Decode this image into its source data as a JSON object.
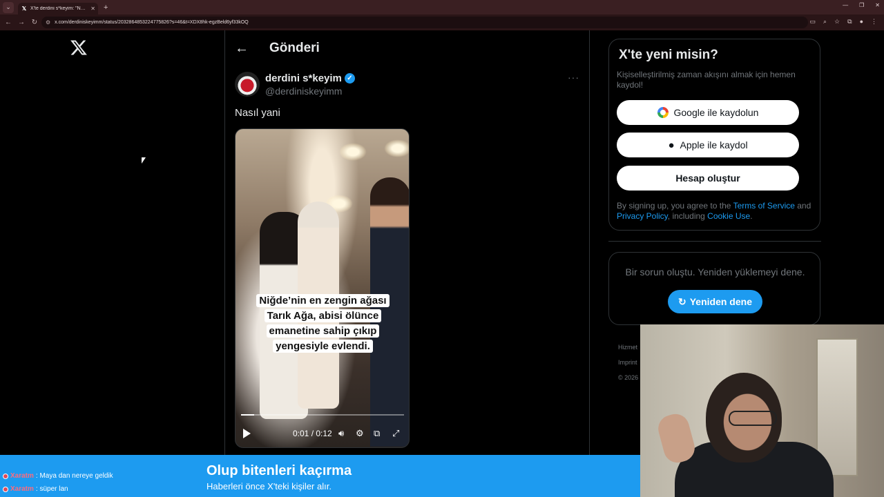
{
  "browser": {
    "tab_title": "X'te derdini s*keyim: \"Nasıl yani\"",
    "url": "x.com/derdiniskeyimm/status/2032864853224775826?s=46&t=XDX8hk-egzBeld6yf33kOQ",
    "tab_close": "✕",
    "new_tab": "+"
  },
  "post": {
    "header_title": "Gönderi",
    "author_name": "derdini s*keyim",
    "author_handle": "@derdiniskeyimm",
    "text": "Nasıl yani",
    "more": "···"
  },
  "video": {
    "caption": "Niğde’nin en zengin ağası Tarık Ağa, abisi ölünce emanetine sahip çıkıp yengesiyle evlendi.",
    "time": "0:01 / 0:12",
    "progress": 0.08
  },
  "signup": {
    "title": "X'te yeni misin?",
    "subtitle": "Kişiselleştirilmiş zaman akışını almak için hemen kaydol!",
    "google_label": "Google ile kaydolun",
    "apple_label": "Apple ile kaydol",
    "create_label": "Hesap oluştur",
    "terms_prefix": "By signing up, you agree to the ",
    "terms_link": "Terms of Service",
    "terms_and": " and ",
    "privacy_link": "Privacy Policy",
    "terms_including": ", including ",
    "cookie_link": "Cookie Use",
    "terms_end": "."
  },
  "error": {
    "text": "Bir sorun oluştu. Yeniden yüklemeyi dene.",
    "retry_label": "Yeniden dene"
  },
  "footer": {
    "line1": "Hizmet",
    "line2": "Imprint",
    "line3": "© 2026"
  },
  "banner": {
    "title": "Olup bitenleri kaçırma",
    "subtitle": "Haberleri önce X'teki kişiler alır."
  },
  "chat": [
    {
      "user": "Xaratm",
      "message": ": Maya dan nereye geldik"
    },
    {
      "user": "Xaratm",
      "message": ": süper lan"
    }
  ],
  "colors": {
    "accent": "#1d9bf0",
    "background": "#000000",
    "muted": "#71767b"
  }
}
